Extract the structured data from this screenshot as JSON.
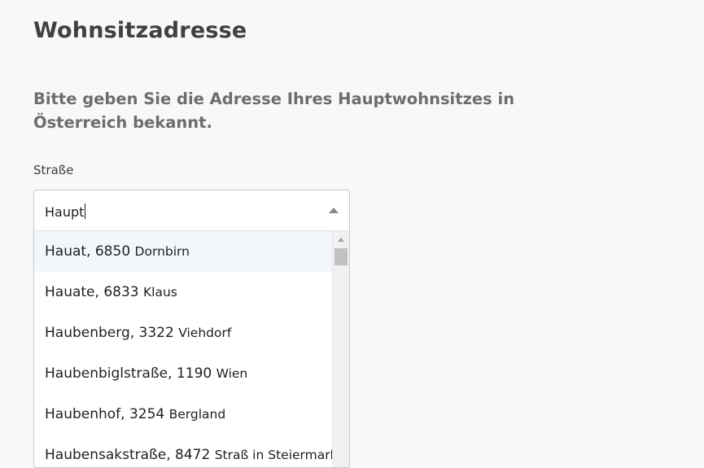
{
  "page": {
    "title": "Wohnsitzadresse",
    "intro": "Bitte geben Sie die Adresse Ihres Hauptwohnsitzes in Österreich bekannt."
  },
  "street_field": {
    "label": "Straße",
    "value": "Haupt",
    "options": [
      {
        "street": "Hauat, 6850",
        "city": "Dornbirn"
      },
      {
        "street": "Hauate, 6833",
        "city": "Klaus"
      },
      {
        "street": "Haubenberg, 3322",
        "city": "Viehdorf"
      },
      {
        "street": "Haubenbiglstraße, 1190",
        "city": "Wien"
      },
      {
        "street": "Haubenhof, 3254",
        "city": "Bergland"
      },
      {
        "street": "Haubensakstraße, 8472",
        "city": "Straß in Steiermark"
      }
    ]
  }
}
